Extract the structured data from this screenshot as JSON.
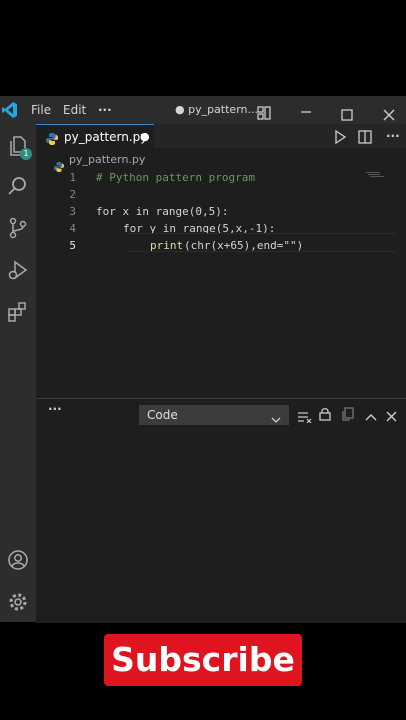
{
  "menu": {
    "file": "File",
    "edit": "Edit",
    "more": "···"
  },
  "titlebar": {
    "title": "● py_pattern..."
  },
  "activity": {
    "badge_count": "1"
  },
  "tab": {
    "label": "py_pattern.py",
    "modified_dot": "●"
  },
  "breadcrumb": {
    "file": "py_pattern.py"
  },
  "code": {
    "line_numbers": [
      "1",
      "2",
      "3",
      "4",
      "5"
    ],
    "line1_comment": "# Python pattern program",
    "line3": "for x in range(0,5):",
    "line4": "for y in range(5,x,-1):",
    "line5_print": "print",
    "line5_rest": "(chr(x+65),end=\"\")"
  },
  "panel": {
    "more": "···",
    "output_source": "Code"
  },
  "overlay": {
    "subscribe_label": "Subscribe"
  },
  "colors": {
    "accent": "#3a86d0",
    "badge": "#2f8f83",
    "subscribe": "#e0141e"
  },
  "icons": [
    "vscode-logo-icon",
    "files-icon",
    "search-icon",
    "source-control-icon",
    "run-debug-icon",
    "extensions-icon",
    "account-icon",
    "settings-gear-icon",
    "run-icon",
    "split-editor-icon",
    "layout-icon",
    "minimize-icon",
    "maximize-icon",
    "close-icon",
    "python-file-icon",
    "chevron-down-icon",
    "clear-output-icon",
    "lock-icon",
    "copy-icon",
    "chevron-up-icon",
    "panel-close-icon"
  ]
}
